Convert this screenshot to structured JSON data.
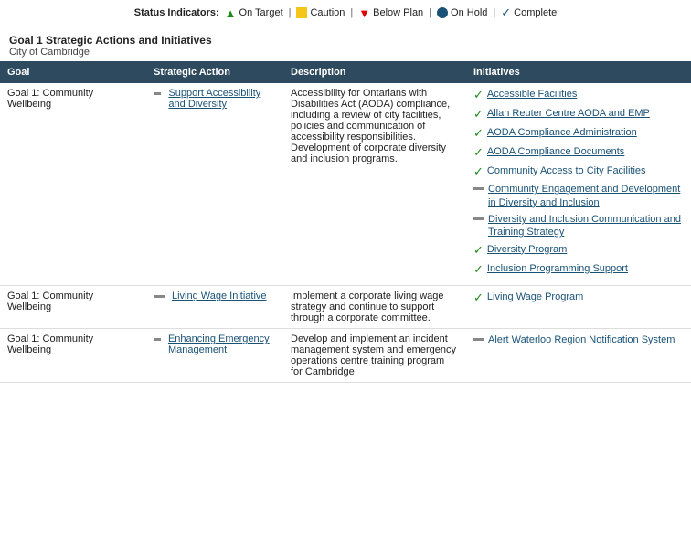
{
  "statusBar": {
    "label": "Status Indicators:",
    "indicators": [
      {
        "icon": "arrow-up",
        "text": "On Target"
      },
      {
        "icon": "caution",
        "text": "Caution"
      },
      {
        "icon": "arrow-down",
        "text": "Below Plan"
      },
      {
        "icon": "onhold",
        "text": "On Hold"
      },
      {
        "icon": "complete",
        "text": "Complete"
      }
    ]
  },
  "pageHeader": {
    "title": "Goal 1 Strategic Actions and Initiatives",
    "subtitle": "City of Cambridge"
  },
  "table": {
    "columns": [
      "Goal",
      "Strategic Action",
      "Description",
      "Initiatives"
    ],
    "rows": [
      {
        "goal": "Goal 1: Community Wellbeing",
        "actionIcon": "dash",
        "action": "Support Accessibility and Diversity",
        "description": "Accessibility for Ontarians with Disabilities Act (AODA) compliance, including a review of city facilities, policies and communication of accessibility responsibilities. Development of corporate diversity and inclusion programs.",
        "initiatives": [
          {
            "icon": "check",
            "text": "Accessible Facilities"
          },
          {
            "icon": "check",
            "text": "Allan Reuter Centre AODA and EMP"
          },
          {
            "icon": "check",
            "text": "AODA Compliance Administration"
          },
          {
            "icon": "check",
            "text": "AODA Compliance Documents"
          },
          {
            "icon": "check",
            "text": "Community Access to City Facilities"
          },
          {
            "icon": "dash",
            "text": "Community Engagement and Development in Diversity and Inclusion"
          },
          {
            "icon": "dash",
            "text": "Diversity and Inclusion Communication and Training Strategy"
          },
          {
            "icon": "check",
            "text": "Diversity Program"
          },
          {
            "icon": "check",
            "text": "Inclusion Programming Support"
          }
        ]
      },
      {
        "goal": "Goal 1: Community Wellbeing",
        "actionIcon": "dash",
        "action": "Living Wage Initiative",
        "description": "Implement a corporate living wage strategy and continue to support through a corporate committee.",
        "initiatives": [
          {
            "icon": "check",
            "text": "Living Wage Program"
          }
        ]
      },
      {
        "goal": "Goal 1: Community Wellbeing",
        "actionIcon": "dash",
        "action": "Enhancing Emergency Management",
        "description": "Develop and implement an incident management system and emergency operations centre training program for Cambridge",
        "initiatives": [
          {
            "icon": "dash",
            "text": "Alert Waterloo Region Notification System"
          }
        ]
      }
    ]
  }
}
